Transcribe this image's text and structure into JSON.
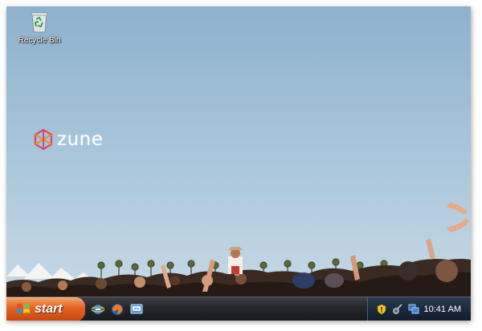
{
  "desktop": {
    "icons": [
      {
        "label": "Recycle Bin",
        "icon": "recycle-bin-icon"
      }
    ],
    "wallpaper_logo": {
      "text": "zune",
      "icon": "zune-logo-icon"
    }
  },
  "taskbar": {
    "start_label": "start",
    "quick_launch": [
      {
        "icon": "internet-explorer-icon"
      },
      {
        "icon": "firefox-icon"
      },
      {
        "icon": "show-desktop-icon"
      }
    ],
    "tray": {
      "icons": [
        "security-shield-icon",
        "network-icon",
        "windows-icon"
      ],
      "clock": "10:41 AM"
    }
  },
  "colors": {
    "sky": "#a3c1d8",
    "start_orange": "#e0631f",
    "taskbar": "#25292e",
    "tray_blue": "#1c2a3d"
  }
}
